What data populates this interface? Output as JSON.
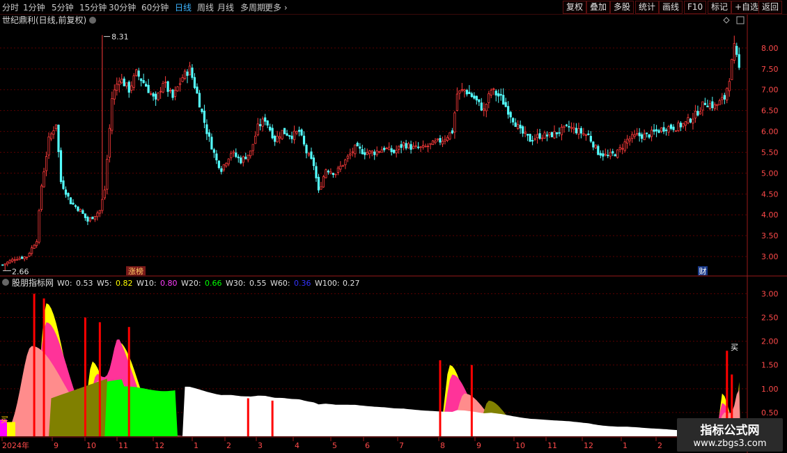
{
  "toolbar": {
    "periods": [
      {
        "label": "分时",
        "active": false
      },
      {
        "label": "1分钟",
        "active": false
      },
      {
        "label": "5分钟",
        "active": false
      },
      {
        "label": "15分钟",
        "active": false
      },
      {
        "label": "30分钟",
        "active": false
      },
      {
        "label": "60分钟",
        "active": false
      },
      {
        "label": "日线",
        "active": true
      },
      {
        "label": "周线",
        "active": false
      },
      {
        "label": "月线",
        "active": false
      },
      {
        "label": "多周期",
        "active": false
      },
      {
        "label": "更多",
        "active": false
      }
    ],
    "more_chevron": "›",
    "actions": [
      "复权",
      "叠加",
      "多股",
      "统计",
      "画线",
      "F10",
      "标记",
      "+自选",
      "返回"
    ]
  },
  "price_panel": {
    "title": "世纪鼎利(日线,前复权)",
    "high_label": "8.31",
    "low_label": "2.66",
    "tag_zhangting": "涨榜",
    "tag_cai": "财",
    "y_ticks": [
      "8.00",
      "7.50",
      "7.00",
      "6.50",
      "6.00",
      "5.50",
      "5.00",
      "4.50",
      "4.00",
      "3.50",
      "3.00"
    ]
  },
  "indicator_panel": {
    "name": "股朋指标网",
    "values": [
      {
        "label": "W0:",
        "value": "0.53",
        "color": "#e0e0e0"
      },
      {
        "label": "W5:",
        "value": "0.82",
        "color": "#ffff00"
      },
      {
        "label": "W10:",
        "value": "0.80",
        "color": "#ff3cff"
      },
      {
        "label": "W20:",
        "value": "0.66",
        "color": "#00ff00"
      },
      {
        "label": "W30:",
        "value": "0.55",
        "color": "#e0e0e0"
      },
      {
        "label": "W60:",
        "value": "0.36",
        "color": "#3333ff"
      },
      {
        "label": "W100:",
        "value": "0.27",
        "color": "#e0e0e0"
      }
    ],
    "y_ticks": [
      "3.00",
      "2.50",
      "2.00",
      "1.50",
      "1.00",
      "0.50"
    ],
    "buy_label": "买"
  },
  "x_axis": {
    "labels": [
      "2024年",
      "9",
      "10",
      "11",
      "12",
      "1",
      "2",
      "3",
      "4",
      "5",
      "6",
      "7",
      "8",
      "9",
      "10",
      "11",
      "12",
      "1",
      "2"
    ]
  },
  "watermark": {
    "title": "指标公式网",
    "url": "www.zbgs3.com"
  },
  "colors": {
    "up": "#ff3b3b",
    "down": "#54ffff",
    "grid": "#5a0000",
    "axis": "#9a1a1a",
    "label": "#ff4a4a",
    "w_white": "#ffffff",
    "w_green": "#00ff00",
    "w_olive": "#808000",
    "w_salmon": "#ff8c8c",
    "w_pink": "#ff3399",
    "w_yellow": "#ffff00",
    "w_red": "#ff0000"
  },
  "chart_data": {
    "type": "candlestick",
    "title": "世纪鼎利(日线,前复权)",
    "ylim": [
      2.55,
      8.5
    ],
    "max": 8.31,
    "min": 2.66,
    "close_path": [
      [
        0,
        2.8
      ],
      [
        5,
        2.95
      ],
      [
        10,
        3.0
      ],
      [
        14,
        3.4
      ],
      [
        16,
        4.7
      ],
      [
        19,
        5.8
      ],
      [
        22,
        6.2
      ],
      [
        24,
        4.8
      ],
      [
        28,
        4.3
      ],
      [
        32,
        4.1
      ],
      [
        35,
        3.85
      ],
      [
        40,
        4.1
      ],
      [
        42,
        4.6
      ],
      [
        45,
        6.8
      ],
      [
        48,
        7.3
      ],
      [
        52,
        7.0
      ],
      [
        55,
        7.4
      ],
      [
        59,
        7.1
      ],
      [
        63,
        6.7
      ],
      [
        66,
        7.2
      ],
      [
        70,
        6.8
      ],
      [
        74,
        7.3
      ],
      [
        77,
        7.5
      ],
      [
        80,
        6.9
      ],
      [
        84,
        6.0
      ],
      [
        88,
        5.3
      ],
      [
        90,
        5.1
      ],
      [
        94,
        5.5
      ],
      [
        98,
        5.3
      ],
      [
        102,
        5.5
      ],
      [
        105,
        6.1
      ],
      [
        108,
        6.3
      ],
      [
        112,
        5.8
      ],
      [
        115,
        6.0
      ],
      [
        119,
        5.9
      ],
      [
        122,
        6.0
      ],
      [
        125,
        5.5
      ],
      [
        128,
        5.2
      ],
      [
        130,
        4.55
      ],
      [
        133,
        5.1
      ],
      [
        137,
        5.0
      ],
      [
        141,
        5.3
      ],
      [
        145,
        5.6
      ],
      [
        149,
        5.5
      ],
      [
        153,
        5.5
      ],
      [
        157,
        5.6
      ],
      [
        161,
        5.5
      ],
      [
        165,
        5.7
      ],
      [
        169,
        5.6
      ],
      [
        173,
        5.6
      ],
      [
        177,
        5.7
      ],
      [
        181,
        5.8
      ],
      [
        185,
        6.0
      ],
      [
        187,
        6.9
      ],
      [
        190,
        7.0
      ],
      [
        194,
        6.8
      ],
      [
        198,
        6.5
      ],
      [
        201,
        7.0
      ],
      [
        205,
        6.8
      ],
      [
        209,
        6.4
      ],
      [
        213,
        6.0
      ],
      [
        217,
        5.8
      ],
      [
        221,
        5.9
      ],
      [
        225,
        5.9
      ],
      [
        229,
        6.0
      ],
      [
        233,
        6.1
      ],
      [
        237,
        6.0
      ],
      [
        241,
        5.9
      ],
      [
        245,
        5.5
      ],
      [
        249,
        5.4
      ],
      [
        253,
        5.5
      ],
      [
        257,
        5.8
      ],
      [
        261,
        5.9
      ],
      [
        265,
        5.9
      ],
      [
        269,
        6.0
      ],
      [
        273,
        6.1
      ],
      [
        277,
        6.1
      ],
      [
        281,
        6.2
      ],
      [
        285,
        6.4
      ],
      [
        289,
        6.7
      ],
      [
        293,
        6.6
      ],
      [
        297,
        6.8
      ],
      [
        299,
        7.3
      ],
      [
        301,
        8.0
      ],
      [
        303,
        7.5
      ]
    ],
    "indicator": {
      "type": "area",
      "series": [
        "W0",
        "W5",
        "W10",
        "W20",
        "W30",
        "W60",
        "W100"
      ],
      "ylim": [
        0,
        3.3
      ]
    }
  }
}
